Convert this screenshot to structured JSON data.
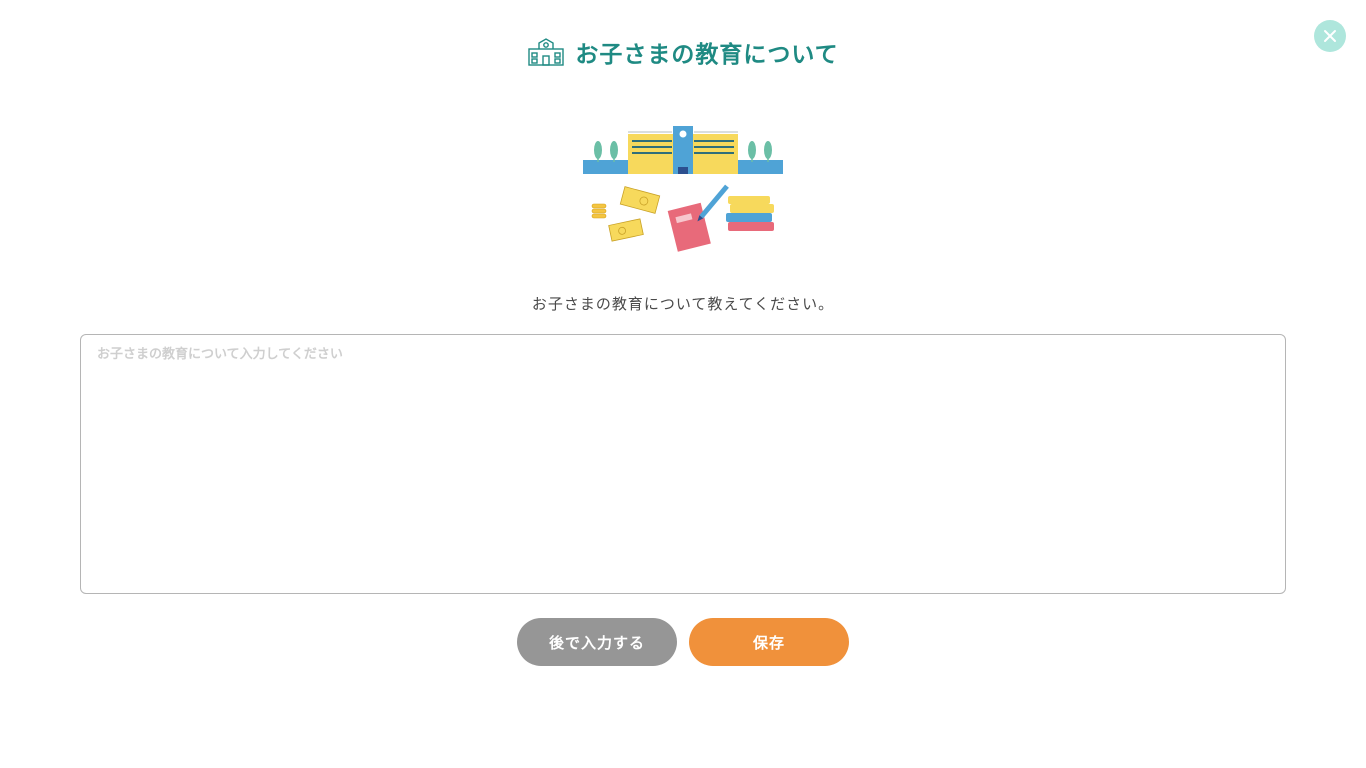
{
  "dialog": {
    "title": "お子さまの教育について",
    "title_icon": "school-building-icon",
    "close_icon": "close-icon",
    "illustration": "school-and-education-illustration",
    "prompt": "お子さまの教育について教えてください。",
    "input": {
      "placeholder": "お子さまの教育について入力してください",
      "value": ""
    },
    "buttons": {
      "later_label": "後で入力する",
      "save_label": "保存"
    }
  },
  "colors": {
    "title": "#1f8a83",
    "close_bg": "#aee6dc",
    "later_button": "#969696",
    "save_button": "#f0913b",
    "border": "#b5b5b5"
  }
}
